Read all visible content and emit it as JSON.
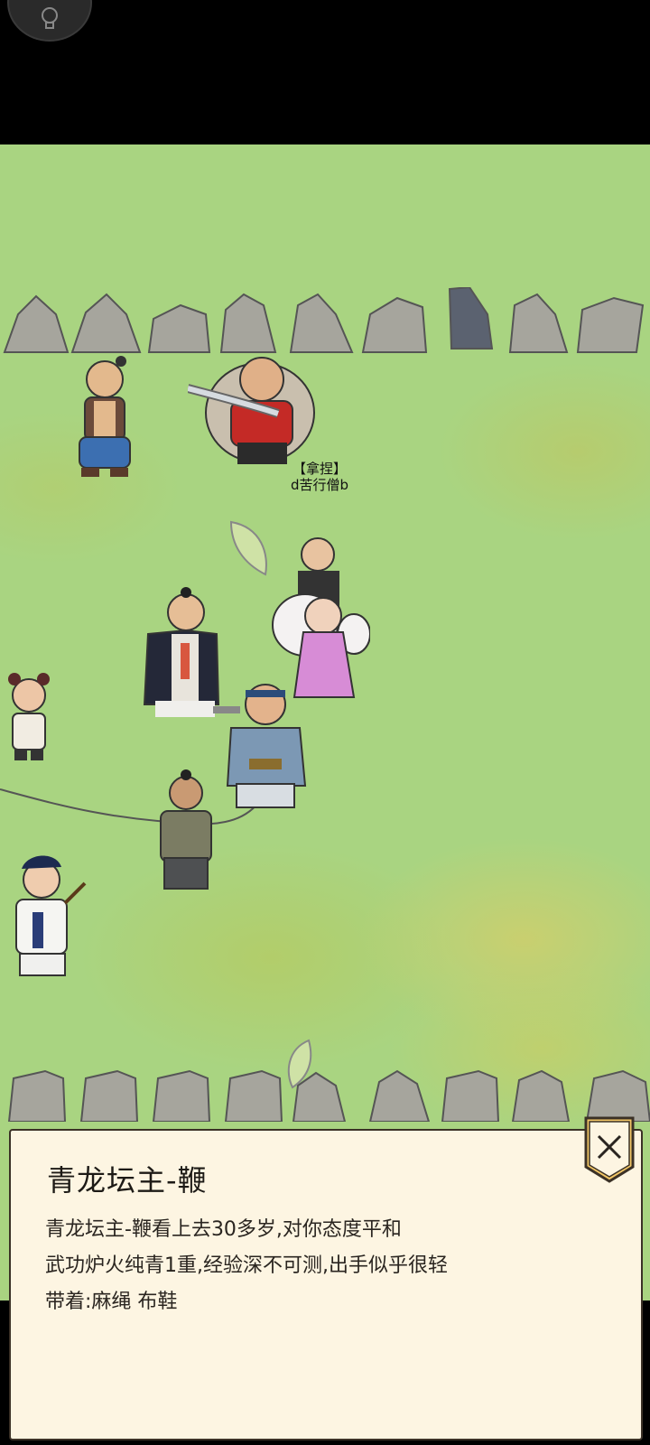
{
  "npc_tag": {
    "action": "【拿捏】",
    "name": "d苦行僧b"
  },
  "panel": {
    "title": "青龙坛主-鞭",
    "lines": [
      "青龙坛主-鞭看上去30多岁,对你态度平和",
      "武功炉火纯青1重,经验深不可测,出手似乎很轻",
      "带着:麻绳 布鞋"
    ]
  },
  "icons": {
    "camera": "bulb-icon",
    "close": "close-icon"
  },
  "colors": {
    "map_green": "#a9d481",
    "panel_bg": "#fdf5e2",
    "badge_gold": "#f3c766"
  }
}
